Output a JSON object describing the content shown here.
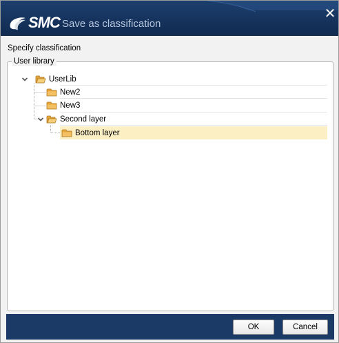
{
  "window": {
    "brand": "SMC",
    "title": "Save as classification",
    "close_glyph": "✕"
  },
  "main": {
    "section_label": "Specify classification",
    "group_label": "User library"
  },
  "tree": {
    "root": {
      "label": "UserLib",
      "expanded": true,
      "icon": "folder-open-icon"
    },
    "items": [
      {
        "label": "New2",
        "icon": "folder-icon"
      },
      {
        "label": "New3",
        "icon": "folder-icon"
      },
      {
        "label": "Second layer",
        "expanded": true,
        "icon": "folder-open-icon"
      },
      {
        "label": "Bottom layer",
        "icon": "folder-icon",
        "selected": true
      }
    ]
  },
  "footer": {
    "ok_label": "OK",
    "cancel_label": "Cancel"
  },
  "colors": {
    "titlebar": "#15325c",
    "footer": "#1c3a66",
    "selection": "#fcefc4",
    "folder": "#e8a73a"
  }
}
